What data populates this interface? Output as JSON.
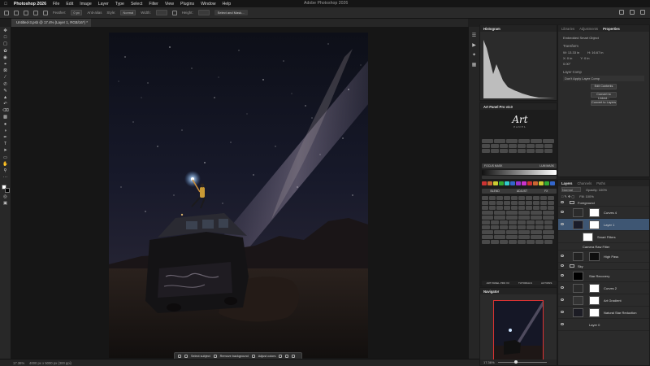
{
  "menubar": {
    "app_name": "Photoshop 2026",
    "items": [
      "File",
      "Edit",
      "Image",
      "Layer",
      "Type",
      "Select",
      "Filter",
      "View",
      "Plugins",
      "Window",
      "Help"
    ],
    "window_title": "Adobe Photoshop 2026"
  },
  "options_bar": {
    "feather_label": "Feather:",
    "feather_value": "0 px",
    "antialias_label": "Anti-alias",
    "style_label": "Style:",
    "style_value": "Normal",
    "width_label": "Width:",
    "height_label": "Height:",
    "select_mask_label": "Select and Mask..."
  },
  "document": {
    "tab_title": "Untitled-3.psb @ 17.4% (Layer 1, RGB/16*) *"
  },
  "status": {
    "zoom": "17.36%",
    "doc_info": "4000 px x 5000 px (300 ppi)"
  },
  "contextual_taskbar": {
    "select_subject": "Select subject",
    "remove_background": "Remove background",
    "adjust_colors": "Adjust colors"
  },
  "histogram_panel": {
    "title": "Histogram"
  },
  "art_panel": {
    "title": "Art Panel Pro v3.0",
    "logo_text": "Art",
    "logo_sub": "PANEL",
    "focus_label": "FOCUS MASK",
    "lum_label": "LUM MASK",
    "buttons": [
      "BLEND",
      "ADJUST",
      "FX"
    ],
    "footer": [
      "ART PANEL PRO V3",
      "TUTORIALS",
      "ACTIONS"
    ]
  },
  "navigator_panel": {
    "title": "Navigator",
    "zoom": "17.36%"
  },
  "properties_panel": {
    "tabs": [
      "Libraries",
      "Adjustments",
      "Properties"
    ],
    "active_tab": "Properties",
    "header": "Embedded Smart Object",
    "transform_label": "Transform",
    "w_label": "W: 13.33 in",
    "h_label": "H: 16.67 in",
    "x_label": "X: 0 in",
    "y_label": "Y: 0 in",
    "angle_label": "0.00°",
    "layer_comp_label": "Layer Comp",
    "layer_comp_value": "Don't Apply Layer Comp",
    "edit_contents": "Edit Contents",
    "convert_linked": "Convert to Linked...",
    "convert_layers": "Convert to Layers"
  },
  "layers_panel": {
    "tabs": [
      "Layers",
      "Channels",
      "Paths"
    ],
    "active_tab": "Layers",
    "kind_label": "Normal",
    "opacity_label": "Opacity: 100%",
    "fill_label": "Fill: 100%",
    "layers": [
      {
        "name": "Foreground",
        "type": "group"
      },
      {
        "name": "Curves 4",
        "type": "adjustment"
      },
      {
        "name": "Layer 1",
        "type": "smart",
        "selected": true
      },
      {
        "name": "Smart Filters",
        "type": "filter"
      },
      {
        "name": "Camera Raw Filter",
        "type": "filter"
      },
      {
        "name": "High Pass",
        "type": "layer"
      },
      {
        "name": "Sky",
        "type": "group"
      },
      {
        "name": "Star Recovery",
        "type": "layer"
      },
      {
        "name": "Curves 2",
        "type": "adjustment"
      },
      {
        "name": "Art Gradient",
        "type": "layer"
      },
      {
        "name": "Natural Star Reduction",
        "type": "layer"
      },
      {
        "name": "Layer 0",
        "type": "layer"
      }
    ]
  },
  "colors": {
    "selection": "#3e5673",
    "accent_red": "#dd3333"
  }
}
